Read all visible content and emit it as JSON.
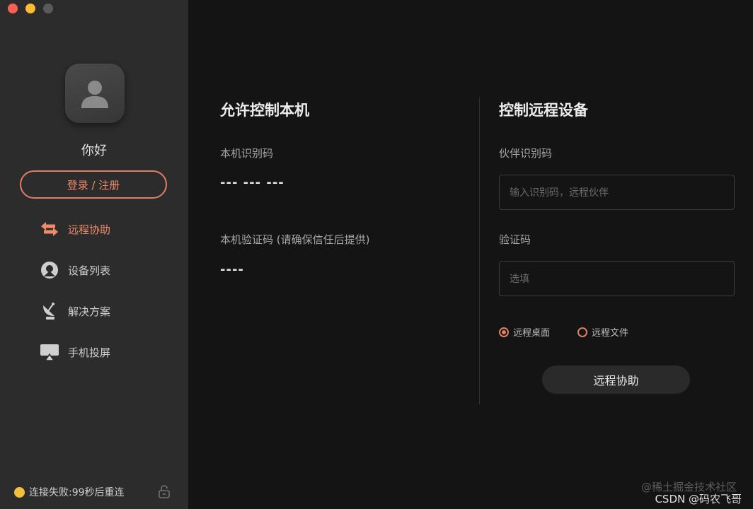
{
  "window": {
    "controls": [
      "close",
      "minimize",
      "maximize"
    ]
  },
  "sidebar": {
    "greeting": "你好",
    "login_label": "登录 / 注册",
    "nav": [
      {
        "label": "远程协助",
        "icon": "swap-arrows-icon",
        "active": true
      },
      {
        "label": "设备列表",
        "icon": "device-list-icon",
        "active": false
      },
      {
        "label": "解决方案",
        "icon": "satellite-dish-icon",
        "active": false
      },
      {
        "label": "手机投屏",
        "icon": "screen-cast-icon",
        "active": false
      }
    ],
    "status_text": "连接失败:99秒后重连",
    "status_color": "#f3c03e"
  },
  "allow": {
    "title": "允许控制本机",
    "id_label": "本机识别码",
    "id_value": "--- --- ---",
    "code_label": "本机验证码 (请确保信任后提供)",
    "code_value": "----"
  },
  "control": {
    "title": "控制远程设备",
    "partner_label": "伙伴识别码",
    "partner_placeholder": "输入识别码，远程伙伴",
    "code_label": "验证码",
    "code_placeholder": "选填",
    "options": [
      {
        "label": "远程桌面",
        "checked": true
      },
      {
        "label": "远程文件",
        "checked": false
      }
    ],
    "connect_label": "远程协助"
  },
  "watermark": {
    "line1": "@稀土掘金技术社区",
    "line2": "CSDN @码农飞哥"
  },
  "colors": {
    "accent": "#e07f62",
    "sidebar_bg": "#2c2c2c",
    "main_bg": "#141414"
  }
}
